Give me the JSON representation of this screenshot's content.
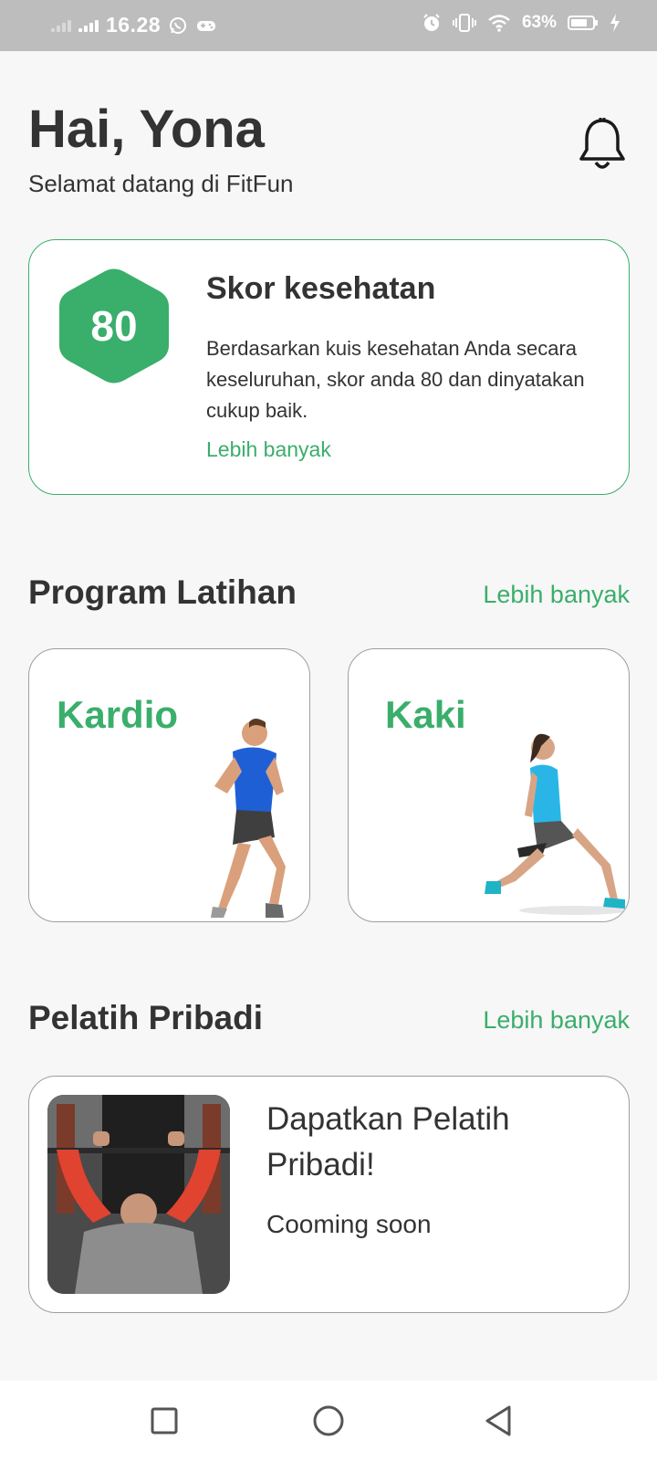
{
  "status_bar": {
    "time": "16.28",
    "battery_percent": "63%",
    "icons": [
      "signal-icon",
      "whatsapp-icon",
      "game-controller-icon",
      "alarm-icon",
      "vibrate-icon",
      "wifi-icon",
      "battery-icon",
      "charging-icon"
    ]
  },
  "header": {
    "greeting": "Hai, Yona",
    "subtitle": "Selamat datang di FitFun",
    "bell_icon": "bell-icon"
  },
  "health_score": {
    "score": "80",
    "title": "Skor kesehatan",
    "description": "Berdasarkan kuis kesehatan Anda secara keseluruhan, skor anda 80 dan dinyatakan cukup baik.",
    "more_label": "Lebih banyak"
  },
  "program": {
    "title": "Program Latihan",
    "more_label": "Lebih banyak",
    "items": [
      {
        "label": "Kardio"
      },
      {
        "label": "Kaki"
      }
    ]
  },
  "trainer": {
    "title": "Pelatih Pribadi",
    "more_label": "Lebih banyak",
    "card_title": "Dapatkan Pelatih Pribadi!",
    "card_subtitle": "Cooming soon"
  },
  "nav": {
    "icons": [
      "recent-apps-icon",
      "home-icon",
      "back-icon"
    ]
  },
  "colors": {
    "accent": "#3aae6b",
    "text": "#333333",
    "background": "#f7f7f7"
  }
}
